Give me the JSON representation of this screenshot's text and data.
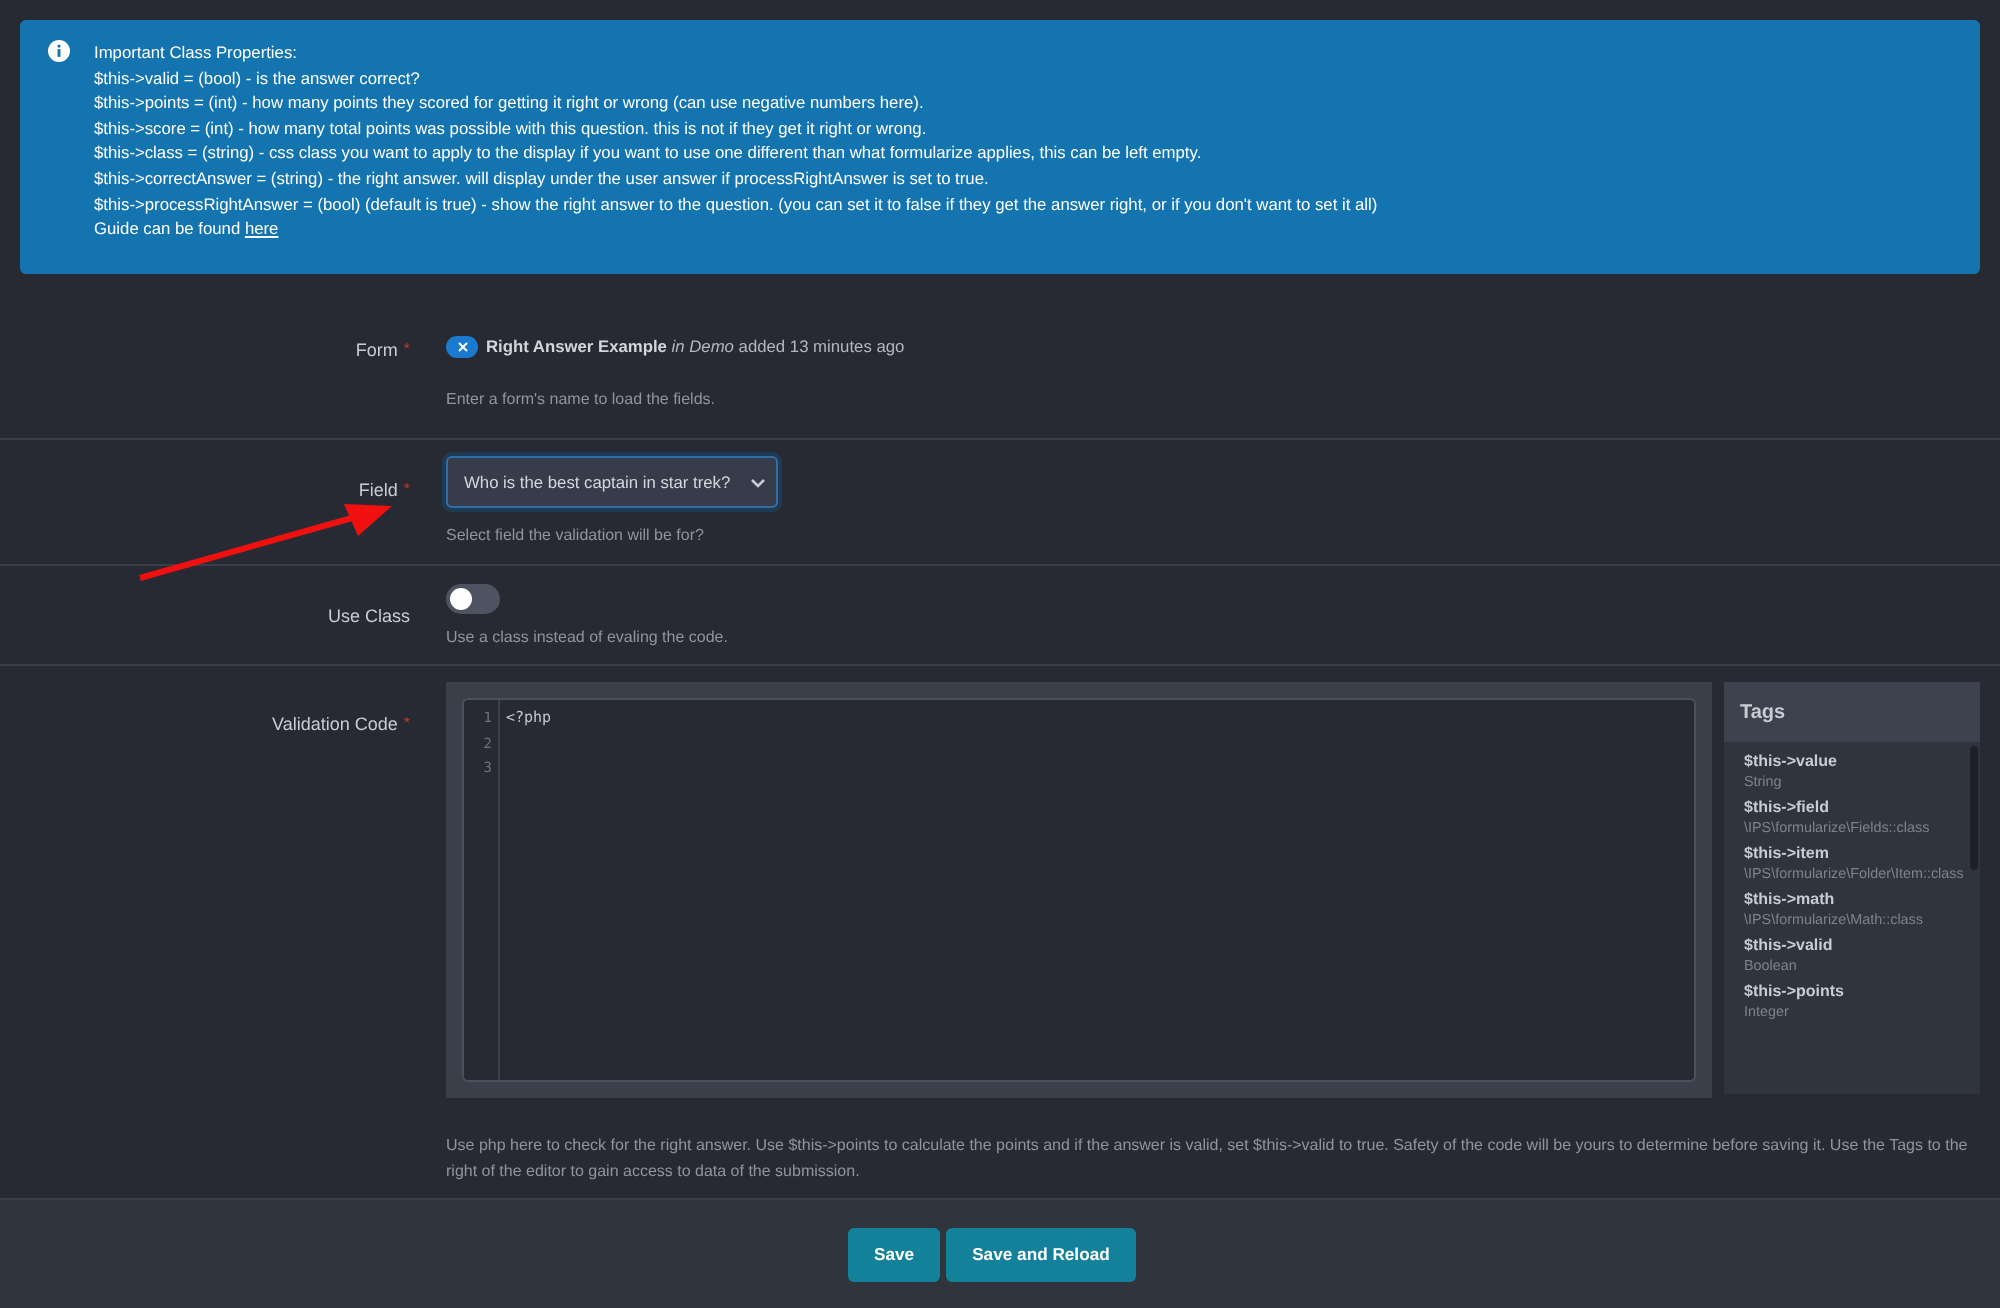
{
  "info": {
    "title": "Important Class Properties:",
    "lines": [
      "$this->valid = (bool) - is the answer correct?",
      "$this->points = (int) - how many points they scored for getting it right or wrong (can use negative numbers here).",
      "$this->score = (int) - how many total points was possible with this question. this is not if they get it right or wrong.",
      "$this->class = (string) - css class you want to apply to the display if you want to use one different than what formularize applies, this can be left empty.",
      "$this->correctAnswer = (string) - the right answer. will display under the user answer if processRightAnswer is set to true.",
      "$this->processRightAnswer = (bool) (default is true) - show the right answer to the question. (you can set it to false if they get the answer right, or if you don't want to set it all)"
    ],
    "guide_text": "Guide can be found",
    "guide_link": "here"
  },
  "rows": [
    {
      "kind": "token",
      "label": "Form",
      "required_mark": "*",
      "token": "**Right Answer Example** *in Demo* added 13 minutes ago",
      "hint": "Enter a form's name to load the fields."
    },
    {
      "kind": "select",
      "label": "Field",
      "required_mark": "*",
      "value": "Who is the best captain in star trek?",
      "hint": "Select field the validation will be for?"
    },
    {
      "kind": "toggle",
      "label": "Use Class",
      "on": false,
      "hint": "Use a class instead of evaling the code."
    },
    {
      "kind": "code",
      "label": "Validation Code",
      "required_mark": "*",
      "line_numbers": [
        "1",
        "2",
        "3"
      ],
      "code": "<?php",
      "tags_title": "Tags",
      "tags": [
        {
          "name": "$this->value",
          "type": "String"
        },
        {
          "name": "$this->field",
          "type": "\\IPS\\formularize\\Fields::class"
        },
        {
          "name": "$this->item",
          "type": "\\IPS\\formularize\\Folder\\Item::class"
        },
        {
          "name": "$this->math",
          "type": "\\IPS\\formularize\\Math::class"
        },
        {
          "name": "$this->valid",
          "type": "Boolean"
        },
        {
          "name": "$this->points",
          "type": "Integer"
        }
      ],
      "hint": "Use php here to check for the right answer. Use $this->points to calculate the points and if the answer is valid, set $this->valid to true. Safety of the code will be yours to determine before saving it. Use the Tags to the right of the editor to gain access to data of the submission."
    }
  ],
  "buttons": [
    "Save",
    "Save and Reload"
  ]
}
